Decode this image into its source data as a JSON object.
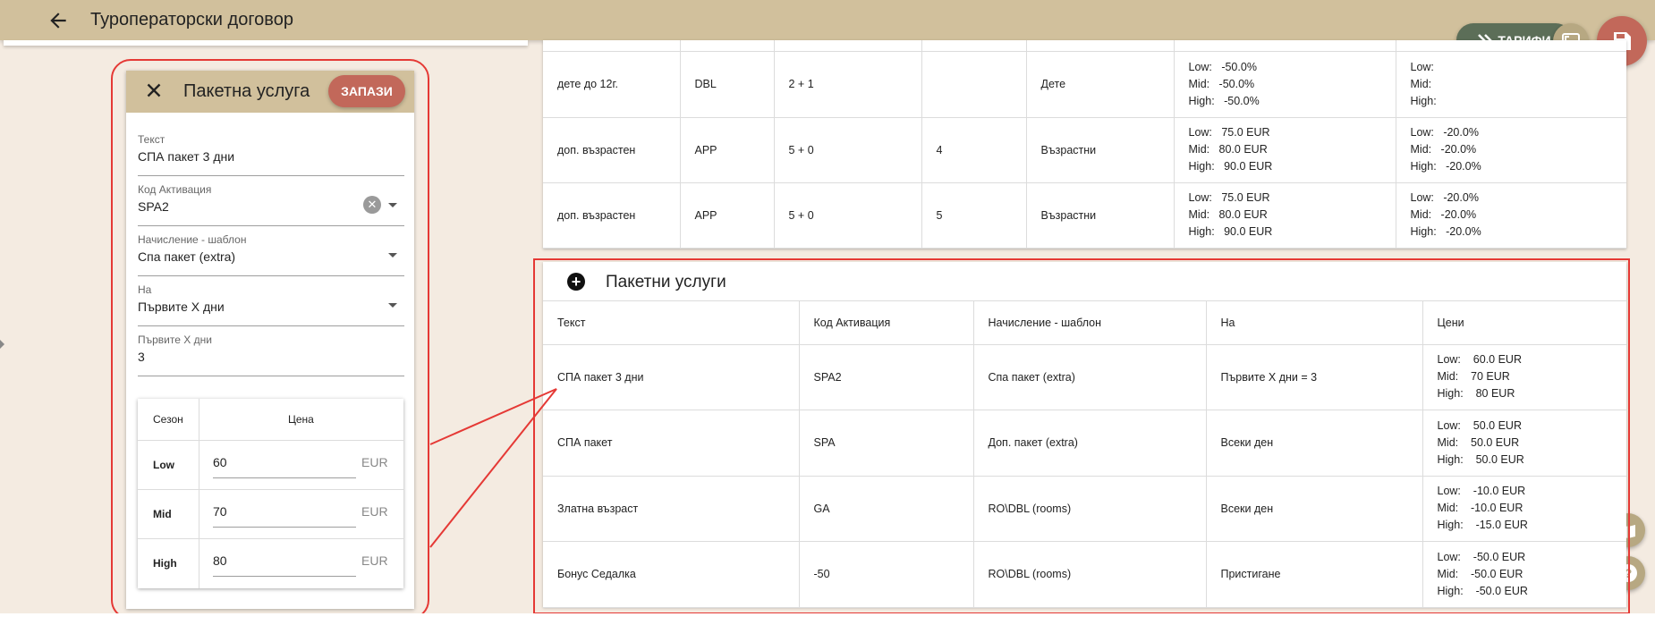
{
  "header": {
    "title": "Туроператорски договор"
  },
  "fabs": {
    "tariffs_label": "ТАРИФИ"
  },
  "upper_table": {
    "rows": [
      {
        "c1": "дете до 12г.",
        "c2": "DBL",
        "c3": "2 + 1",
        "c4": "",
        "c5": "Дете",
        "c6": [
          "Low:   -50.0%",
          "Mid:   -50.0%",
          "High:   -50.0%"
        ],
        "c7": [
          "Low:",
          "Mid:",
          "High:"
        ]
      },
      {
        "c1": "доп. възрастен",
        "c2": "APP",
        "c3": "5 + 0",
        "c4": "4",
        "c5": "Възрастни",
        "c6": [
          "Low:   75.0 EUR",
          "Mid:   80.0 EUR",
          "High:   90.0 EUR"
        ],
        "c7": [
          "Low:   -20.0%",
          "Mid:   -20.0%",
          "High:   -20.0%"
        ]
      },
      {
        "c1": "доп. възрастен",
        "c2": "APP",
        "c3": "5 + 0",
        "c4": "5",
        "c5": "Възрастни",
        "c6": [
          "Low:   75.0 EUR",
          "Mid:   80.0 EUR",
          "High:   90.0 EUR"
        ],
        "c7": [
          "Low:   -20.0%",
          "Mid:   -20.0%",
          "High:   -20.0%"
        ]
      }
    ]
  },
  "package_services": {
    "title": "Пакетни услуги",
    "columns": [
      "Текст",
      "Код Активация",
      "Начисление - шаблон",
      "На",
      "Цени"
    ],
    "rows": [
      {
        "text": "СПА пакет 3 дни",
        "code": "SPA2",
        "template": "Спа пакет (extra)",
        "on": "Първите X дни = 3",
        "prices": [
          "Low:    60.0 EUR",
          "Mid:    70 EUR",
          "High:    80 EUR"
        ]
      },
      {
        "text": "СПА пакет",
        "code": "SPA",
        "template": "Доп. пакет (extra)",
        "on": "Всеки ден",
        "prices": [
          "Low:    50.0 EUR",
          "Mid:    50.0 EUR",
          "High:    50.0 EUR"
        ]
      },
      {
        "text": "Златна възраст",
        "code": "GA",
        "template": "RO\\DBL (rooms)",
        "on": "Всеки ден",
        "prices": [
          "Low:    -10.0 EUR",
          "Mid:    -10.0 EUR",
          "High:    -15.0 EUR"
        ]
      },
      {
        "text": "Бонус Седалка",
        "code": "-50",
        "template": "RO\\DBL (rooms)",
        "on": "Пристигане",
        "prices": [
          "Low:    -50.0 EUR",
          "Mid:    -50.0 EUR",
          "High:    -50.0 EUR"
        ]
      }
    ]
  },
  "panel": {
    "title": "Пакетна услуга",
    "save_label": "ЗАПАЗИ",
    "fields": {
      "text": {
        "label": "Текст",
        "value": "СПА пакет 3 дни"
      },
      "activation_code": {
        "label": "Код Активация",
        "value": "SPA2"
      },
      "charge_template": {
        "label": "Начисление - шаблон",
        "value": "Спа пакет (extra)"
      },
      "on": {
        "label": "На",
        "value": "Първите X дни"
      },
      "first_x_days": {
        "label": "Първите X дни",
        "value": "3"
      }
    },
    "price_table": {
      "season_header": "Сезон",
      "price_header": "Цена",
      "rows": [
        {
          "season": "Low",
          "value": "60",
          "currency": "EUR"
        },
        {
          "season": "Mid",
          "value": "70",
          "currency": "EUR"
        },
        {
          "season": "High",
          "value": "80",
          "currency": "EUR"
        }
      ]
    }
  },
  "colors": {
    "topbar": "#d1c09c",
    "background": "#f4ebe1",
    "save_accent": "#c2685a",
    "tariffs_fab": "#5c6e58",
    "highlight": "#e53935"
  }
}
